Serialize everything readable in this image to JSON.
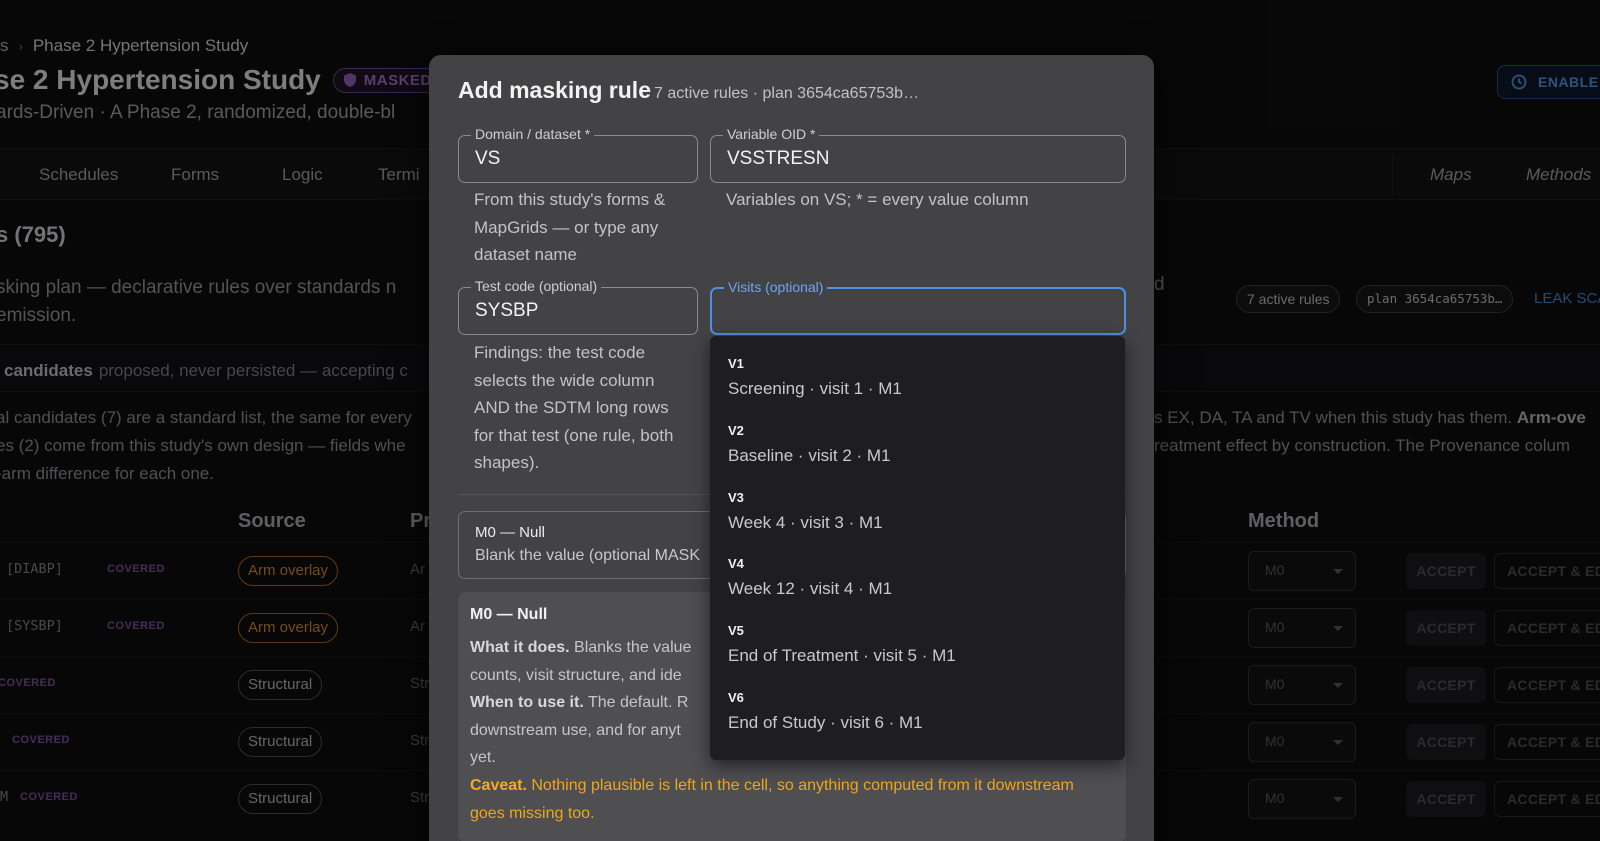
{
  "breadcrumb": {
    "prev": "s",
    "current": "Phase 2 Hypertension Study"
  },
  "page": {
    "title": "se 2 Hypertension Study",
    "badge": "MASKED",
    "subtitle": "ards-Driven · A Phase 2, randomized, double-bl",
    "enable_button": "ENABLE T"
  },
  "tabs": [
    "Schedules",
    "Forms",
    "Logic",
    "Termi"
  ],
  "tabs_right": [
    "Maps",
    "Methods"
  ],
  "section": {
    "count_title": "s (795)",
    "desc_line1": "sking plan — declarative rules over standards n",
    "desc_line2": "emission.",
    "desc_tail": "d",
    "pill_rules": "7 active rules",
    "pill_plan": "plan 3654ca65753b…",
    "leak_link": "LEAK SCA"
  },
  "candidates": {
    "title": "candidates",
    "subtitle": "proposed, never persisted — accepting c",
    "body_left": [
      "al candidates (7) are a standard list, the same for every",
      "es (2) come from this study's own design — fields whe",
      "-arm difference for each one."
    ],
    "body_right_1": "s EX, DA, TA and TV when this study has them.",
    "body_right_1_bold": "Arm-ove",
    "body_right_2": "reatment effect by construction. The Provenance colum"
  },
  "table": {
    "headers": {
      "source": "Source",
      "pr": "Pr",
      "method": "Method"
    },
    "rows": [
      {
        "var": "[DIABP]",
        "covered": "COVERED",
        "source": "Arm overlay",
        "pr": "Ar",
        "method": "M0",
        "accept": "ACCEPT",
        "accept_edit": "ACCEPT & ED"
      },
      {
        "var": "[SYSBP]",
        "covered": "COVERED",
        "source": "Arm overlay",
        "pr": "Ar",
        "method": "M0",
        "accept": "ACCEPT",
        "accept_edit": "ACCEPT & ED"
      },
      {
        "var": "",
        "covered": "COVERED",
        "source": "Structural",
        "pr": "Str",
        "method": "M0",
        "accept": "ACCEPT",
        "accept_edit": "ACCEPT & ED"
      },
      {
        "var": "",
        "covered": "COVERED",
        "source": "Structural",
        "pr": "Str",
        "method": "M0",
        "accept": "ACCEPT",
        "accept_edit": "ACCEPT & ED"
      },
      {
        "var": "M",
        "covered": "COVERED",
        "source": "Structural",
        "pr": "Str",
        "method": "M0",
        "accept": "ACCEPT",
        "accept_edit": "ACCEPT & ED"
      }
    ]
  },
  "modal": {
    "title": "Add masking rule",
    "meta": "7 active rules · plan 3654ca65753b…",
    "domain": {
      "label": "Domain / dataset *",
      "value": "VS",
      "helper": "From this study's forms & MapGrids — or type any dataset name"
    },
    "variable": {
      "label": "Variable OID *",
      "value": "VSSTRESN",
      "helper": "Variables on VS; * = every value column"
    },
    "testcode": {
      "label": "Test code (optional)",
      "value": "SYSBP",
      "helper": "Findings: the test code selects the wide column AND the SDTM long rows for that test (one rule, both shapes)."
    },
    "visits": {
      "label": "Visits (optional)",
      "value": ""
    },
    "method": {
      "name": "M0 — Null",
      "desc": "Blank the value (optional MASK"
    },
    "info": {
      "heading": "M0 — Null",
      "what_label": "What it does.",
      "what_text": "Blanks the value",
      "line2": "counts, visit structure, and ide",
      "when_label": "When to use it.",
      "when_text": "The default. R",
      "line4": "downstream use, and for anyt",
      "line5": "yet.",
      "caveat_label": "Caveat.",
      "caveat_text": "Nothing plausible is left in the cell, so anything computed from it downstream goes missing too."
    }
  },
  "visits_dropdown": [
    {
      "code": "V1",
      "label": "Screening · visit 1 · M1"
    },
    {
      "code": "V2",
      "label": "Baseline · visit 2 · M1"
    },
    {
      "code": "V3",
      "label": "Week 4 · visit 3 · M1"
    },
    {
      "code": "V4",
      "label": "Week 12 · visit 4 · M1"
    },
    {
      "code": "V5",
      "label": "End of Treatment · visit 5 · M1"
    },
    {
      "code": "V6",
      "label": "End of Study · visit 6 · M1"
    }
  ]
}
